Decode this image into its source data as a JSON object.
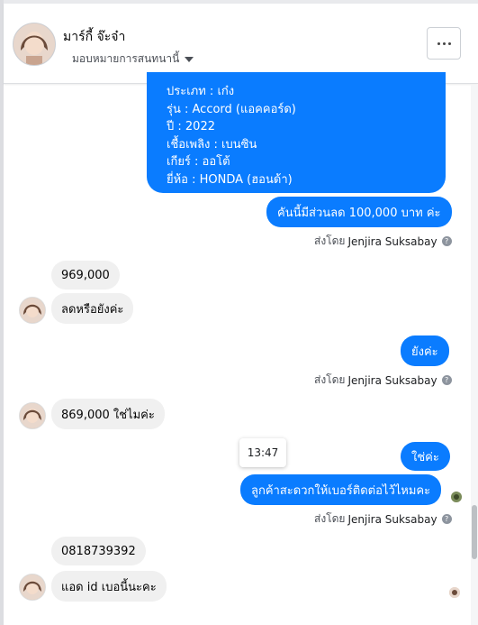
{
  "header": {
    "contact_name": "มาร์กี้ จ๊ะจ๋า",
    "assign_label": "มอบหมายการสนทนานี้",
    "more_label": "..."
  },
  "vehicle_details": [
    "ประเภท : เก๋ง",
    "รุ่น : Accord (แอคคอร์ด)",
    "ปี : 2022",
    "เชื้อเพลิง : เบนซิน",
    "เกียร์ : ออโต้",
    "ยี่ห้อ : HONDA (ฮอนด้า)"
  ],
  "messages": {
    "discount": "คันนี้มีส่วนลด 100,000 บาท ค่ะ",
    "price_969": "969,000",
    "ask_discount": "ลดหรือยังค่ะ",
    "not_yet": "ยังค่ะ",
    "price_869": "869,000 ใช่ไมค่ะ",
    "yes": "ใช่ค่ะ",
    "ask_phone": "ลูกค้าสะดวกให้เบอร์ติดต่อไว้ไหมคะ",
    "phone": "0818739392",
    "line_id": "แอด id เบอนี้นะคะ"
  },
  "sent_by": {
    "prefix": "ส่งโดย",
    "agent": "Jenjira Suksabay"
  },
  "tooltip_time": "13:47",
  "colors": {
    "outgoing": "#0a7cff",
    "incoming": "#f0f0f0"
  }
}
